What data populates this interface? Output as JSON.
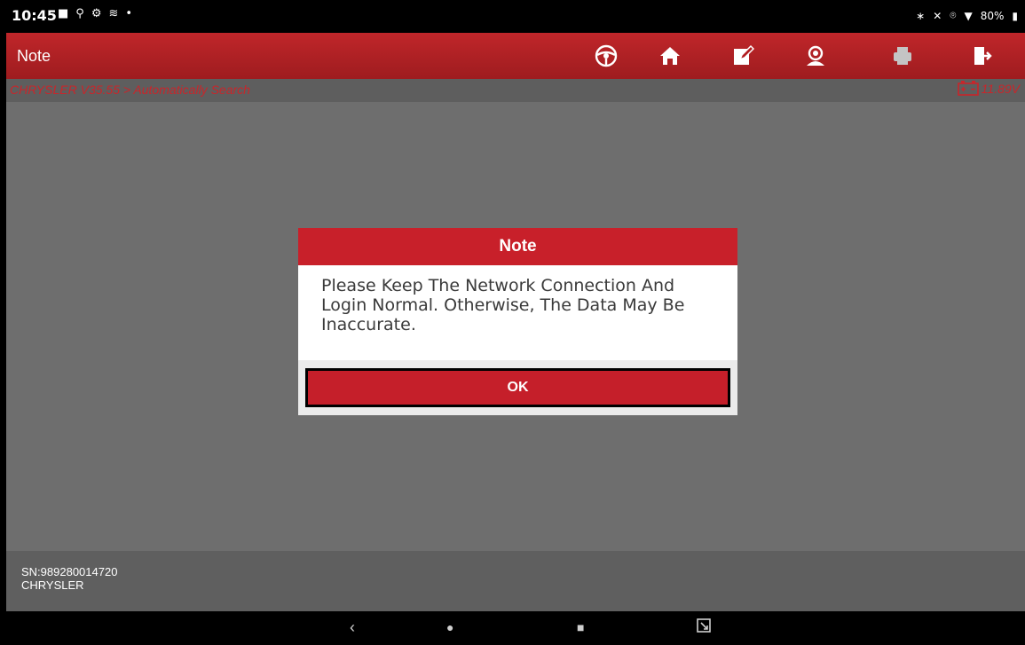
{
  "status_bar": {
    "time": "10:45",
    "battery": "80%"
  },
  "header": {
    "title": "Note",
    "toolbar_icons": [
      "steering-wheel-icon",
      "home-icon",
      "edit-icon",
      "support-agent-icon",
      "print-icon",
      "exit-icon"
    ]
  },
  "breadcrumb": {
    "path": "CHRYSLER V35.55 > Automatically Search",
    "voltage": "11.89V"
  },
  "dialog": {
    "title": "Note",
    "message": "Please Keep The Network Connection And Login Normal. Otherwise, The Data May Be Inaccurate.",
    "ok_label": "OK"
  },
  "footer": {
    "sn": "SN:989280014720",
    "make": "CHRYSLER"
  },
  "nav": {
    "back": "‹",
    "home": "●",
    "recents": "■"
  },
  "colors": {
    "brand_red": "#c0262a",
    "background_gray": "#6e6e6e"
  }
}
